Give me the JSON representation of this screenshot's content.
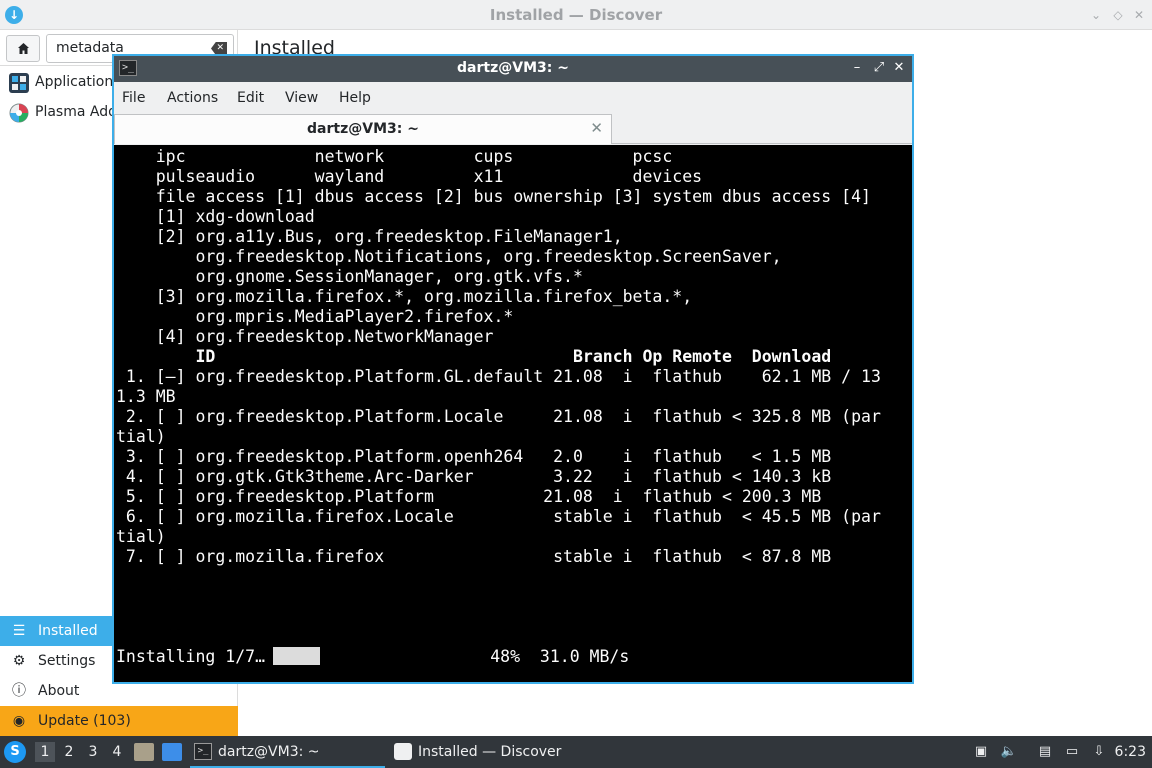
{
  "discover": {
    "title": "Installed — Discover",
    "search_value": "metadata",
    "categories": [
      {
        "label": "Applications"
      },
      {
        "label": "Plasma Addons"
      }
    ],
    "main_title": "Installed",
    "nav": [
      {
        "label": "Installed",
        "icon": "list-icon"
      },
      {
        "label": "Settings",
        "icon": "gear-icon"
      },
      {
        "label": "About",
        "icon": "info-icon"
      },
      {
        "label": "Update (103)",
        "icon": "update-icon"
      }
    ]
  },
  "konsole": {
    "title": "dartz@VM3: ~",
    "menu": [
      "File",
      "Actions",
      "Edit",
      "View",
      "Help"
    ],
    "tab_label": "dartz@VM3: ~",
    "lines": [
      "    ipc             network         cups            pcsc",
      "    pulseaudio      wayland         x11             devices",
      "    file access [1] dbus access [2] bus ownership [3] system dbus access [4]",
      "",
      "    [1] xdg-download",
      "    [2] org.a11y.Bus, org.freedesktop.FileManager1,",
      "        org.freedesktop.Notifications, org.freedesktop.ScreenSaver,",
      "        org.gnome.SessionManager, org.gtk.vfs.*",
      "    [3] org.mozilla.firefox.*, org.mozilla.firefox_beta.*,",
      "        org.mpris.MediaPlayer2.firefox.*",
      "    [4] org.freedesktop.NetworkManager",
      "",
      "",
      ""
    ],
    "table_header": "        ID                                    Branch Op Remote  Download",
    "table_rows": [
      " 1. [—] org.freedesktop.Platform.GL.default 21.08  i  flathub    62.1 MB / 13",
      "1.3 MB",
      " 2. [ ] org.freedesktop.Platform.Locale     21.08  i  flathub < 325.8 MB (par",
      "tial)",
      " 3. [ ] org.freedesktop.Platform.openh264   2.0    i  flathub   < 1.5 MB",
      " 4. [ ] org.gtk.Gtk3theme.Arc-Darker        3.22   i  flathub < 140.3 kB",
      " 5. [ ] org.freedesktop.Platform           21.08  i  flathub < 200.3 MB",
      " 6. [ ] org.mozilla.firefox.Locale          stable i  flathub  < 45.5 MB (par",
      "tial)",
      " 7. [ ] org.mozilla.firefox                 stable i  flathub  < 87.8 MB"
    ],
    "status_prefix": "Installing 1/7…",
    "progress": 0.48,
    "status_suffix": "            48%  31.0 MB/s"
  },
  "taskbar": {
    "desktops": [
      "1",
      "2",
      "3",
      "4"
    ],
    "tasks": [
      {
        "label": "dartz@VM3: ~"
      },
      {
        "label": "Installed — Discover"
      }
    ],
    "clock": "6:23"
  },
  "colors": {
    "accent": "#3daee9",
    "update": "#f8a617",
    "terminal_bg": "#000000",
    "taskbar_bg": "#31363b"
  }
}
